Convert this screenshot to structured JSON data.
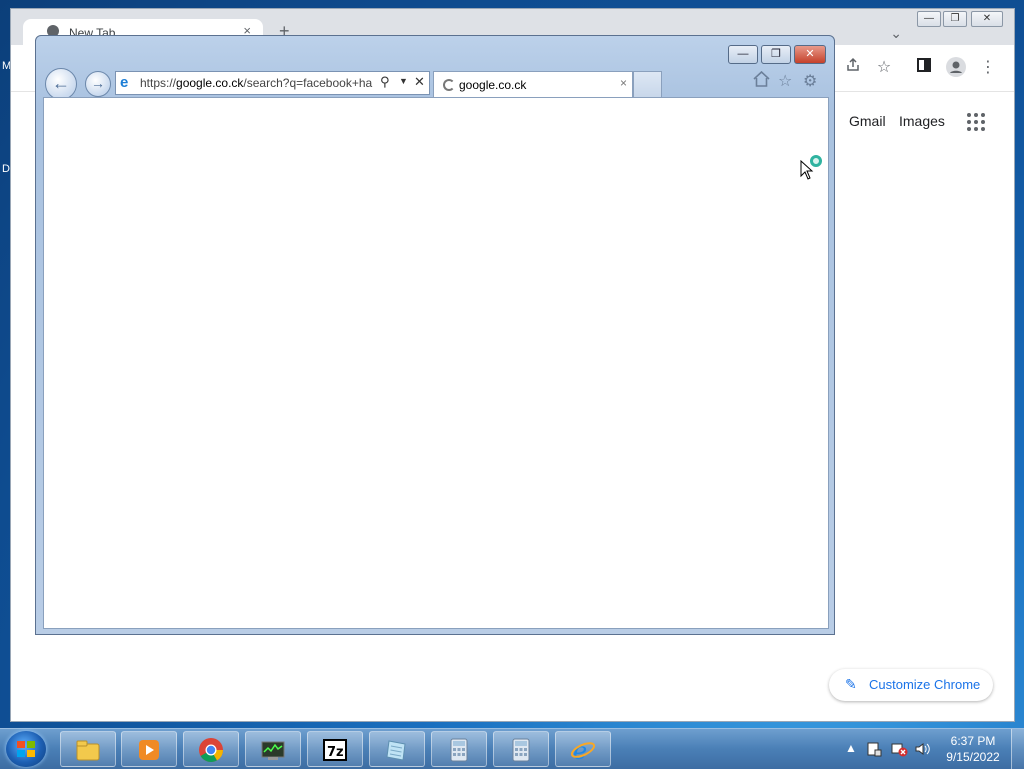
{
  "desktop": {
    "left_letters": [
      "M",
      "D"
    ]
  },
  "chrome": {
    "tab_title": "New Tab",
    "new_tab_symbol": "+",
    "tab_close": "×",
    "dropdown": "⌄",
    "gmail": "Gmail",
    "images": "Images",
    "customize_label": "Customize Chrome",
    "window_buttons": [
      "—",
      "❐",
      "✕"
    ]
  },
  "ie": {
    "address_scheme": "https://",
    "address_domain": "google.co.ck",
    "address_path": "/search?q=facebook+ha",
    "tab_title": "google.co.ck",
    "tab_close": "×",
    "stop_label": "✕",
    "caption_buttons": {
      "minimize": "—",
      "restore": "❐",
      "close": "✕"
    }
  },
  "taskbar": {
    "pinned": [
      "Windows Explorer",
      "Windows Media Player",
      "Google Chrome",
      "Task Manager",
      "7-Zip",
      "Notepad",
      "Calculator",
      "Calculator",
      "Internet Explorer"
    ],
    "time": "6:37 PM",
    "date": "9/15/2022",
    "tray_expand": "▲"
  },
  "colors": {
    "ie_frame": "#b9cde6",
    "chrome_accent": "#1a73e8",
    "taskbar": "#4a7fb6"
  }
}
